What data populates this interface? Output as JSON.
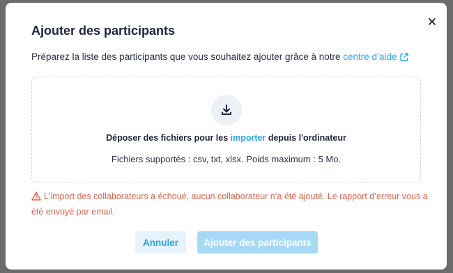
{
  "modal": {
    "title": "Ajouter des participants",
    "intro_text": "Préparez la liste des participants que vous souhaitez ajouter grâce à notre ",
    "help_link": "centre d’aide"
  },
  "dropzone": {
    "text_before": "Déposer des fichiers pour les ",
    "import_link": "importer",
    "text_after": " depuis l'ordinateur",
    "formats": "Fichiers supportés : csv, txt, xlsx. Poids maximum : 5 Mo."
  },
  "error": {
    "message": "L'import des collaborateurs a échoué, aucun collaborateur n’a été ajouté. Le rapport d’erreur vous a été envoyé par email."
  },
  "buttons": {
    "cancel": "Annuler",
    "add": "Ajouter des participants"
  },
  "colors": {
    "accent": "#2aa6e8",
    "error": "#e0624a",
    "title": "#1d2440"
  },
  "icons": [
    "close-icon",
    "external-link-icon",
    "download-icon",
    "warning-icon"
  ]
}
